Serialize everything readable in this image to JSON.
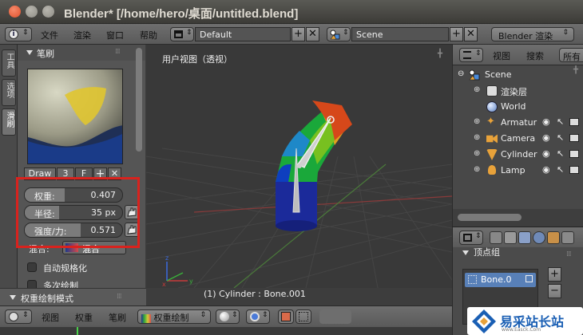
{
  "window": {
    "title": "Blender* [/home/hero/桌面/untitled.blend]"
  },
  "topbar": {
    "menus": [
      "文件",
      "渲染",
      "窗口",
      "帮助"
    ],
    "screen_layout": "Default",
    "scene": "Scene",
    "render_engine": "Blender 渲染"
  },
  "tool_tabs": [
    "工具",
    "选项",
    "滑刷"
  ],
  "brush_panel": {
    "title": "笔刷",
    "brush_name": "Draw",
    "user_count": "3",
    "fake_user": "F",
    "sliders": [
      {
        "label": "权重:",
        "value": "0.407",
        "fraction": 0.407
      },
      {
        "label": "半径:",
        "value": "35 px",
        "fraction": 0.35
      },
      {
        "label": "强度/力:",
        "value": "0.571",
        "fraction": 0.571
      }
    ],
    "blend_label": "混合:",
    "blend_value": "混合",
    "auto_normalize": "自动规格化",
    "multi_paint": "多次绘制"
  },
  "mode_panel": {
    "title": "权重绘制模式"
  },
  "viewport": {
    "label": "用户视图（透视）",
    "selection": "(1) Cylinder : Bone.001"
  },
  "outliner": {
    "header": [
      "视图",
      "搜索",
      "所有场"
    ],
    "rows": [
      {
        "name": "Scene",
        "icon": "scene-icon",
        "color": "#8fb7e3"
      },
      {
        "name": "渲染层",
        "icon": "render-layers-icon",
        "color": "#c8c8c8"
      },
      {
        "name": "World",
        "icon": "world-icon",
        "color": "#a7c2e8"
      },
      {
        "name": "Armatur",
        "icon": "armature-icon",
        "color": "#e8a23a"
      },
      {
        "name": "Camera",
        "icon": "camera-icon",
        "color": "#e8a23a"
      },
      {
        "name": "Cylinder",
        "icon": "mesh-icon",
        "color": "#e8a23a"
      },
      {
        "name": "Lamp",
        "icon": "lamp-icon",
        "color": "#e8a23a"
      }
    ]
  },
  "properties": {
    "panel_title": "顶点组",
    "vertex_group": "Bone.0"
  },
  "bottombar": {
    "items": [
      "视图",
      "权重",
      "笔刷"
    ],
    "mode": "权重绘制"
  },
  "watermark": {
    "text": "易采站长站",
    "sub": "www.Easck.Com"
  }
}
